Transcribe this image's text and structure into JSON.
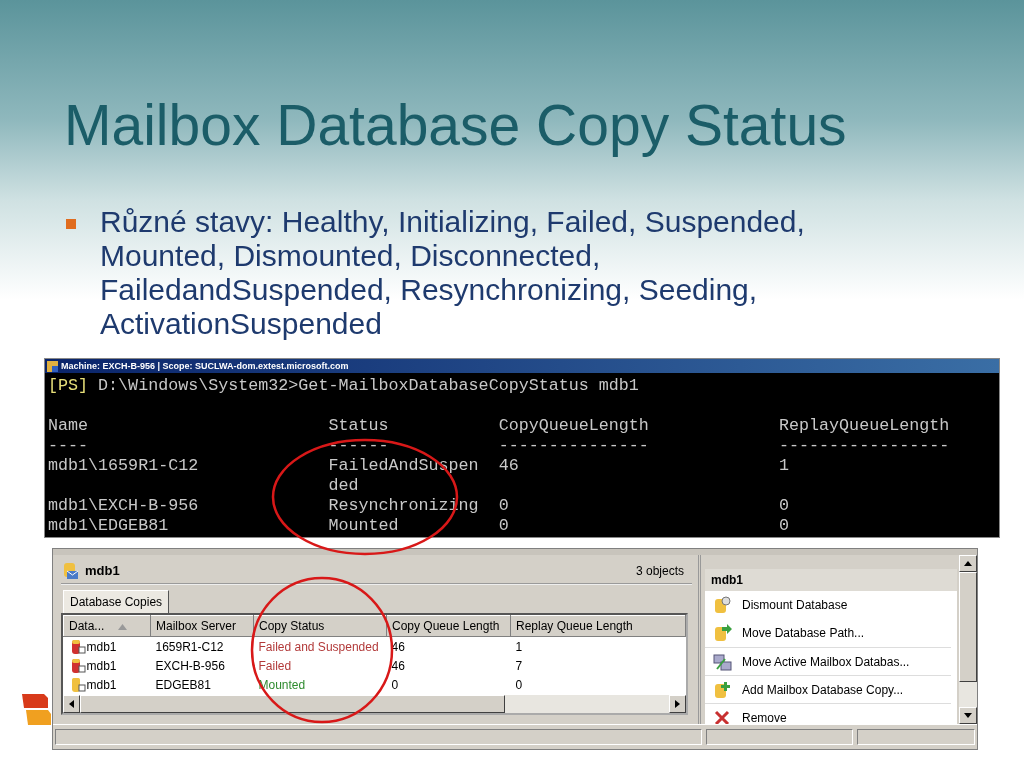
{
  "slide": {
    "title": "Mailbox Database Copy Status",
    "bullets": [
      "Různé stavy: Healthy, Initializing, Failed, Suspended, Mounted, Dismounted, Disconnected, FailedandSuspended, Resynchronizing, Seeding, ActivationSuspended"
    ]
  },
  "console": {
    "title": "Machine: EXCH-B-956 | Scope: SUCLWA-dom.extest.microsoft.com",
    "prompt_tag": "[PS]",
    "command": "D:\\Windows\\System32>Get-MailboxDatabaseCopyStatus mdb1",
    "columns": [
      {
        "label": "Name",
        "underline": "----"
      },
      {
        "label": "Status",
        "underline": "------"
      },
      {
        "label": "CopyQueueLength",
        "underline": "---------------"
      },
      {
        "label": "ReplayQueueLength",
        "underline": "-----------------"
      }
    ],
    "rows": [
      [
        "mdb1\\1659R1-C12",
        "FailedAndSuspended",
        "46",
        "1"
      ],
      [
        "mdb1\\EXCH-B-956",
        "Resynchronizing",
        "0",
        "0"
      ],
      [
        "mdb1\\EDGEB81",
        "Mounted",
        "0",
        "0"
      ]
    ]
  },
  "management_console": {
    "header": {
      "title": "mdb1",
      "count": "3 objects"
    },
    "tabs": [
      {
        "label": "Database Copies",
        "selected": true
      }
    ],
    "table": {
      "columns": [
        {
          "label": "Data...",
          "sorted": true
        },
        {
          "label": "Mailbox Server",
          "sorted": false
        },
        {
          "label": "Copy Status",
          "sorted": false
        },
        {
          "label": "Copy Queue Length",
          "sorted": false
        },
        {
          "label": "Replay Queue Length",
          "sorted": false
        }
      ],
      "rows": [
        {
          "kind": "failed",
          "database": "mdb1",
          "server": "1659R1-C12",
          "status": "Failed and Suspended",
          "color": "#b23a3a",
          "copy_queue": "46",
          "replay_queue": "1"
        },
        {
          "kind": "failed",
          "database": "mdb1",
          "server": "EXCH-B-956",
          "status": "Failed",
          "color": "#b23a3a",
          "copy_queue": "46",
          "replay_queue": "7"
        },
        {
          "kind": "healthy",
          "database": "mdb1",
          "server": "EDGEB81",
          "status": "Mounted",
          "color": "#2e8b2e",
          "copy_queue": "0",
          "replay_queue": "0"
        }
      ]
    },
    "actions": {
      "title": "mdb1",
      "items": [
        {
          "kind": "dismount",
          "label": "Dismount Database"
        },
        {
          "kind": "move-path",
          "label": "Move Database Path..."
        },
        {
          "kind": "move-active",
          "label": "Move Active Mailbox Databas..."
        },
        {
          "kind": "add-copy",
          "label": "Add Mailbox Database Copy..."
        },
        {
          "kind": "remove",
          "label": "Remove"
        }
      ]
    }
  }
}
